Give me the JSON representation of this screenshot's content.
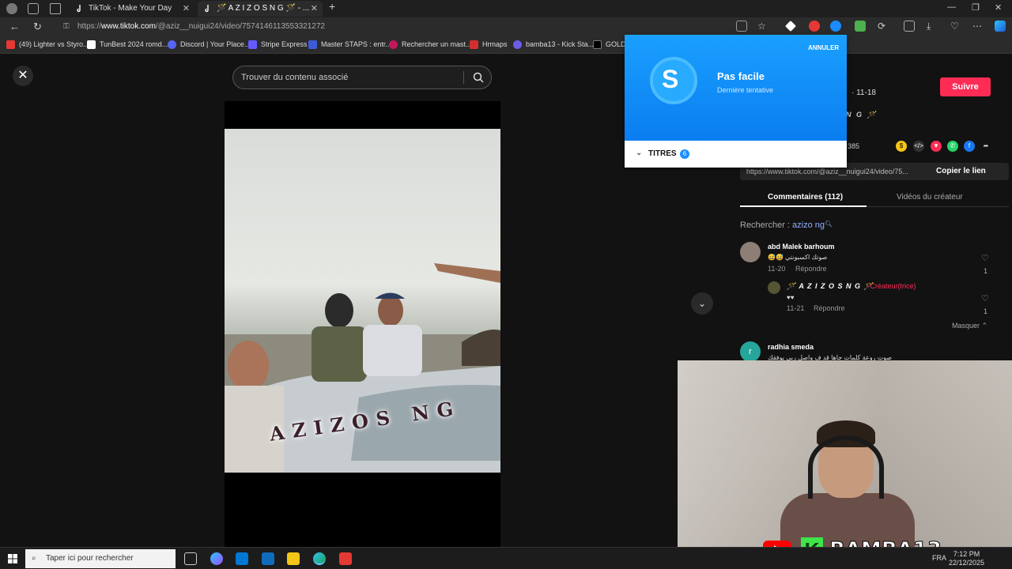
{
  "browser": {
    "tabs": [
      {
        "label": "TikTok - Make Your Day",
        "active": false
      },
      {
        "label": "🪄 A Z I Z O S N G 🪄 - ...",
        "active": true
      }
    ],
    "url_prefix": "https://",
    "url_host": "www.tiktok.com",
    "url_path": "/@aziz__nuigui24/video/7574146113553321272"
  },
  "bookmarks": [
    {
      "label": "(49) Lighter vs Styro...",
      "color": "#e53935"
    },
    {
      "label": "TunBest 2024 romd...",
      "color": "#ffffff"
    },
    {
      "label": "Discord | Your Place...",
      "color": "#5865f2"
    },
    {
      "label": "Stripe Express",
      "color": "#635bff"
    },
    {
      "label": "Master STAPS : entr...",
      "color": "#3b5bdb"
    },
    {
      "label": "Rechercher un mast...",
      "color": "#c2185b"
    },
    {
      "label": "Hrmaps",
      "color": "#d32f2f"
    },
    {
      "label": "bamba13 - Kick Sta...",
      "color": "#6c5ce7"
    },
    {
      "label": "GOLD",
      "color": "#000000"
    }
  ],
  "viewer": {
    "search_placeholder": "Trouver du contenu associé",
    "video_overlay_text": "AZIZOS NG"
  },
  "shazam": {
    "title": "Pas facile",
    "subtitle": "Dernière tentative",
    "cancel": "ANNULER",
    "titres_label": "TITRES",
    "titres_count": "6"
  },
  "side": {
    "follow": "Suivre",
    "date": "· 11-18",
    "handle_frag": "N G 🪄",
    "share_count": "385",
    "link": "https://www.tiktok.com/@aziz__nuigui24/video/75...",
    "copy_link": "Copier le lien",
    "tab_comments": "Commentaires (112)",
    "tab_creator": "Vidéos du créateur",
    "related_prefix": "Rechercher : ",
    "related_term": "azizo ng",
    "hide_replies": "Masquer ⌃"
  },
  "comments": [
    {
      "name": "abd Malek barhoum",
      "text": "😅😅 صوتك اكسبونتي",
      "date": "11-20",
      "reply": "Répondre",
      "likes": "1"
    },
    {
      "name": "🪄 A Z I Z O S N G 🪄",
      "creator": "· Créateur(trice)",
      "text": "♥♥",
      "date": "11-21",
      "reply": "Répondre",
      "likes": "1"
    },
    {
      "name": "radhia smeda",
      "initial": "r",
      "text": "صوت روعة كلمات جاها قد ف واصل ربي يوفقك"
    }
  ],
  "stream_overlay": {
    "brand": "BAMBA13",
    "k": "K"
  },
  "taskbar": {
    "search": "Taper ici pour rechercher",
    "lang": "FRA",
    "time": "7:12 PM",
    "date": "22/12/2025"
  }
}
